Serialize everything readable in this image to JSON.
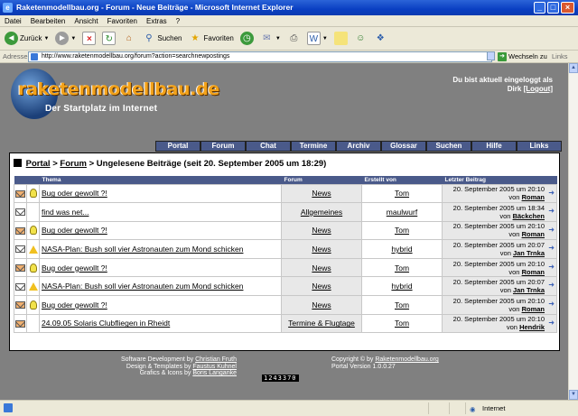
{
  "window": {
    "title": "Raketenmodellbau.org - Forum - Neue Beiträge - Microsoft Internet Explorer"
  },
  "menu": [
    "Datei",
    "Bearbeiten",
    "Ansicht",
    "Favoriten",
    "Extras",
    "?"
  ],
  "toolbar": {
    "back": "Zurück",
    "search": "Suchen",
    "favorites": "Favoriten"
  },
  "address": {
    "label": "Adresse",
    "url": "http://www.raketenmodellbau.org/forum?action=searchnewpostings",
    "go": "Wechseln zu",
    "links": "Links"
  },
  "status": {
    "zone": "Internet"
  },
  "site": {
    "logo_text": "raketenmodellbau.de",
    "slogan": "Der Startplatz im Internet",
    "login_line1": "Du bist aktuell eingeloggt als",
    "user_name": "Dirk",
    "logout": "[Logout]"
  },
  "nav": [
    "Portal",
    "Forum",
    "Chat",
    "Termine",
    "Archiv",
    "Glossar",
    "Suchen",
    "Hilfe",
    "Links"
  ],
  "breadcrumb": {
    "portal": "Portal",
    "sep": ">",
    "forum": "Forum",
    "current": "> Ungelesene Beiträge (seit 20. September 2005 um 18:29)"
  },
  "table": {
    "headers": [
      "Thema",
      "Forum",
      "Erstellt von",
      "Letzter Beitrag"
    ],
    "rows": [
      {
        "icon1": "new-mail",
        "icon2": "bulb",
        "topic": "Bug oder gewollt ?!",
        "forum": "News",
        "author": "Tom",
        "date": "20. September 2005 um 20:10",
        "by": "von",
        "last_user": "Roman"
      },
      {
        "icon1": "mail",
        "icon2": "",
        "topic": "find was net...",
        "forum": "Allgemeines",
        "author": "maulwurf",
        "date": "20. September 2005 um 18:34",
        "by": "von",
        "last_user": "Bäckchen"
      },
      {
        "icon1": "new-mail",
        "icon2": "bulb",
        "topic": "Bug oder gewollt ?!",
        "forum": "News",
        "author": "Tom",
        "date": "20. September 2005 um 20:10",
        "by": "von",
        "last_user": "Roman"
      },
      {
        "icon1": "mail",
        "icon2": "warn",
        "topic": "NASA-Plan: Bush soll vier Astronauten zum Mond schicken",
        "forum": "News",
        "author": "hybrid",
        "date": "20. September 2005 um 20:07",
        "by": "von",
        "last_user": "Jan Trnka"
      },
      {
        "icon1": "new-mail",
        "icon2": "bulb",
        "topic": "Bug oder gewollt ?!",
        "forum": "News",
        "author": "Tom",
        "date": "20. September 2005 um 20:10",
        "by": "von",
        "last_user": "Roman"
      },
      {
        "icon1": "mail",
        "icon2": "warn",
        "topic": "NASA-Plan: Bush soll vier Astronauten zum Mond schicken",
        "forum": "News",
        "author": "hybrid",
        "date": "20. September 2005 um 20:07",
        "by": "von",
        "last_user": "Jan Trnka"
      },
      {
        "icon1": "new-mail",
        "icon2": "bulb",
        "topic": "Bug oder gewollt ?!",
        "forum": "News",
        "author": "Tom",
        "date": "20. September 2005 um 20:10",
        "by": "von",
        "last_user": "Roman"
      },
      {
        "icon1": "new-mail",
        "icon2": "",
        "topic": "24.09.05 Solaris Clubfliegen in Rheidt",
        "forum": "Termine & Flugtage",
        "author": "Tom",
        "date": "20. September 2005 um 20:10",
        "by": "von",
        "last_user": "Hendrik"
      }
    ]
  },
  "footer": {
    "dev_label": "Software Development by",
    "dev_name": "Christian Fruth",
    "design_label": "Design & Templates by",
    "design_name": "Faustus Kuhnel",
    "gfx_label": "Grafics & Icons by",
    "gfx_name": "Boris Langanke",
    "copyright_label": "Copyright © by",
    "copyright_name": "Raketenmodellbau.org",
    "version": "Portal Version 1.0.0.27",
    "counter": "1243370"
  }
}
